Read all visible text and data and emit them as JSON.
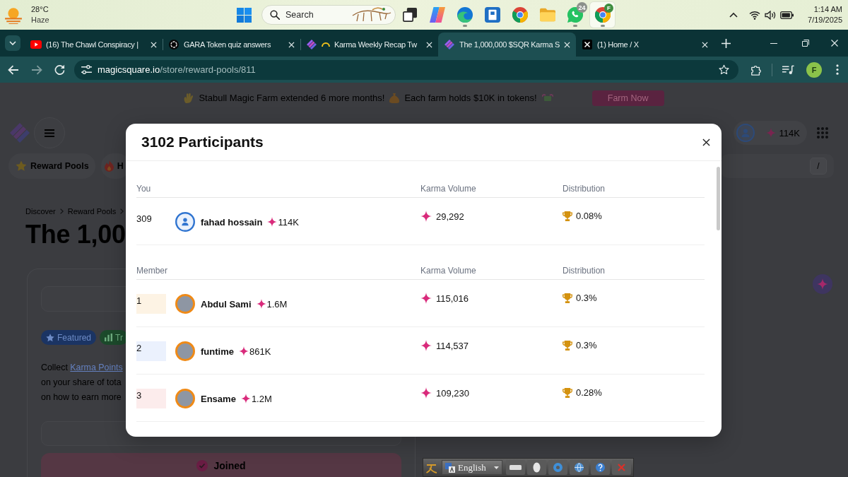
{
  "taskbar": {
    "weather": {
      "temperature": "28°C",
      "condition": "Haze"
    },
    "search": {
      "placeholder": "Search"
    },
    "apps": [
      {
        "kind": "task-view",
        "open": false,
        "selected": false
      },
      {
        "kind": "copilot",
        "open": false,
        "selected": false
      },
      {
        "kind": "edge",
        "open": true,
        "selected": false
      },
      {
        "kind": "document",
        "open": false,
        "selected": false
      },
      {
        "kind": "chrome",
        "open": false,
        "selected": false
      },
      {
        "kind": "files",
        "open": false,
        "selected": false
      },
      {
        "kind": "whatsapp",
        "badge": "24",
        "open": true,
        "selected": false
      },
      {
        "kind": "chrome-profile",
        "badge": "F",
        "open": true,
        "selected": true
      }
    ],
    "clock": {
      "time": "1:14 AM",
      "date": "7/19/2025"
    }
  },
  "browser": {
    "tabs": [
      {
        "icons": [
          {
            "kind": "youtube"
          }
        ],
        "title": "(16) The Chawl Conspiracy |",
        "selected": false
      },
      {
        "icons": [
          {
            "kind": "chat"
          }
        ],
        "title": "GARA Token quiz answers",
        "selected": false
      },
      {
        "icons": [
          {
            "kind": "magicsquare"
          },
          {
            "kind": "swirl"
          }
        ],
        "title": "Karma Weekly Recap Tw",
        "selected": false
      },
      {
        "icons": [
          {
            "kind": "magicsquare"
          }
        ],
        "title": "The 1,000,000 $SQR Karma S",
        "selected": true
      },
      {
        "icons": [
          {
            "kind": "x"
          }
        ],
        "title": "(1) Home / X",
        "selected": false
      }
    ],
    "url": {
      "host": "magicsquare.io",
      "path": "/store/reward-pools/811"
    },
    "profile_initial": "F"
  },
  "page": {
    "banner": {
      "message": "Stabull Magic Farm extended 6 more months!",
      "detail": "Each farm holds $10K in tokens!",
      "button": "Farm Now"
    },
    "header": {
      "karma": "114K"
    },
    "nav_tabs": [
      {
        "kind": "star",
        "label": "Reward Pools"
      },
      {
        "kind": "flame",
        "label": "H"
      }
    ],
    "search": {
      "shortcut": "/"
    },
    "breadcrumb": [
      "Discover",
      "Reward Pools"
    ],
    "title": "The 1,00",
    "tags": [
      {
        "kind": "featured",
        "label": "Featured"
      },
      {
        "kind": "trending",
        "label": "Tr"
      }
    ],
    "description": {
      "lead": "Collect",
      "link": "Karma Points",
      "lines": [
        "on your share of tota",
        "on how to earn more"
      ]
    },
    "action_button": {
      "label": "Joined"
    }
  },
  "modal": {
    "title": "3102 Participants",
    "you": {
      "columns": [
        "You",
        "Karma Volume",
        "Distribution"
      ],
      "row": {
        "rank": "309",
        "name": "fahad hossain",
        "karma": "114K",
        "volume": "29,292",
        "share": "0.08%"
      }
    },
    "members": {
      "columns": [
        "Member",
        "Karma Volume",
        "Distribution"
      ],
      "rows": [
        {
          "rank": "1",
          "color": "#fdf3e4",
          "name": "Abdul Sami",
          "karma": "1.6M",
          "volume": "115,016",
          "share": "0.3%"
        },
        {
          "rank": "2",
          "color": "#ebf1fd",
          "name": "funtime",
          "karma": "861K",
          "volume": "114,537",
          "share": "0.3%"
        },
        {
          "rank": "3",
          "color": "#fcecec",
          "name": "Ensame",
          "karma": "1.2M",
          "volume": "109,230",
          "share": "0.28%"
        }
      ]
    }
  },
  "language_bar": {
    "language": "English"
  }
}
